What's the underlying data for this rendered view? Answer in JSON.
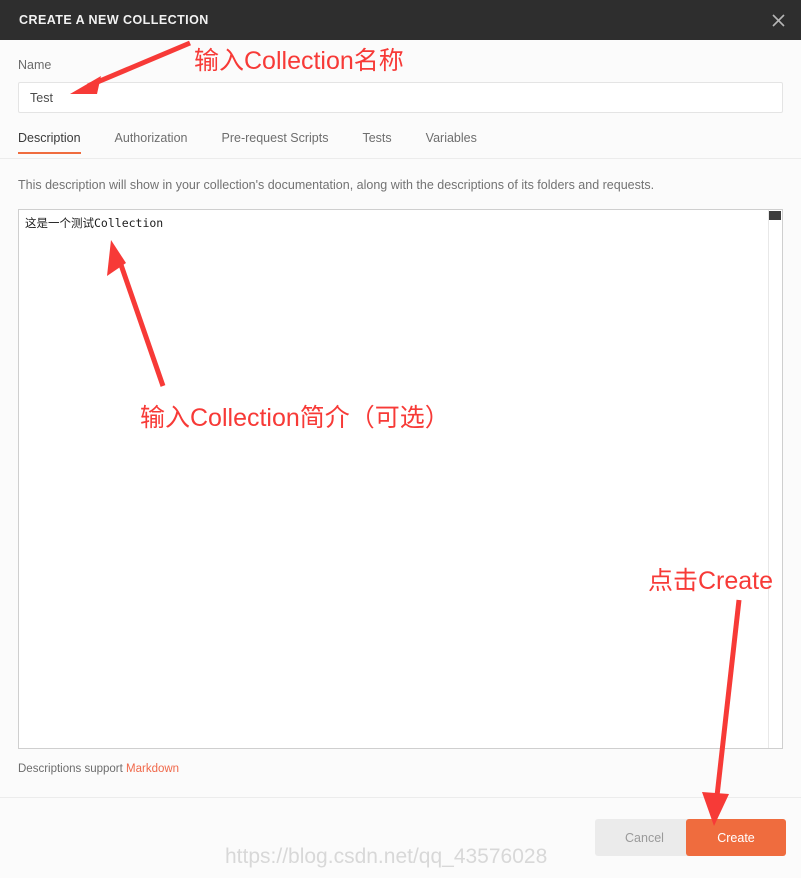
{
  "header": {
    "title": "CREATE A NEW COLLECTION",
    "close_icon": "close-icon"
  },
  "form": {
    "name_label": "Name",
    "name_value": "Test",
    "name_placeholder": ""
  },
  "tabs": [
    {
      "label": "Description",
      "active": true
    },
    {
      "label": "Authorization",
      "active": false
    },
    {
      "label": "Pre-request Scripts",
      "active": false
    },
    {
      "label": "Tests",
      "active": false
    },
    {
      "label": "Variables",
      "active": false
    }
  ],
  "description": {
    "hint": "This description will show in your collection's documentation, along with the descriptions of its folders and requests.",
    "value": "这是一个测试Collection",
    "markdown_note_prefix": "Descriptions support ",
    "markdown_link": "Markdown"
  },
  "footer": {
    "cancel_label": "Cancel",
    "create_label": "Create"
  },
  "annotations": [
    {
      "id": "name",
      "text": "输入Collection名称"
    },
    {
      "id": "desc",
      "text": "输入Collection简介（可选）"
    },
    {
      "id": "create",
      "text": "点击Create"
    }
  ],
  "watermark": "https://blog.csdn.net/qq_43576028",
  "colors": {
    "header_bg": "#2e2e2e",
    "accent": "#ef6c3e",
    "annotation": "#f73a37",
    "body_bg": "#fbfbfb",
    "markdown_link": "#f0684a"
  }
}
